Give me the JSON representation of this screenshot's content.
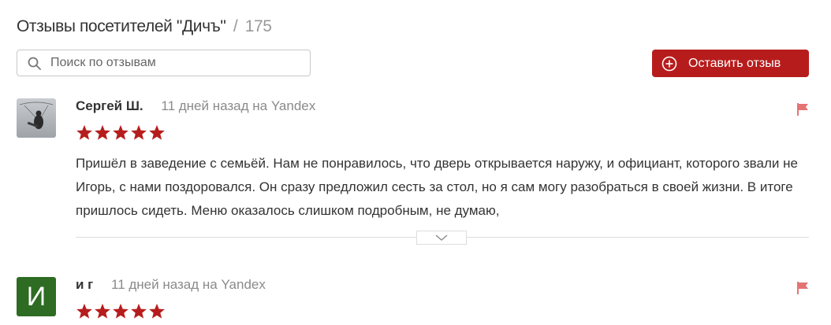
{
  "header": {
    "title": "Отзывы посетителей \"Дичъ\"",
    "separator": "/",
    "count": "175"
  },
  "search": {
    "placeholder": "Поиск по отзывам",
    "icon": "search-icon"
  },
  "add_review": {
    "label": "Оставить отзыв",
    "icon": "plus-circle-icon",
    "color": "#b71c1c"
  },
  "reviews": [
    {
      "author": "Сергей Ш.",
      "date": "11 дней назад на Yandex",
      "rating": 5,
      "avatar": "photo",
      "text": "Пришёл в заведение с семьёй. Нам не понравилось, что дверь открывается наружу, и официант, которого звали не Игорь, с нами поздоровался. Он сразу предложил сесть за стол, но я сам могу разобраться в своей жизни. В итоге пришлось сидеть. Меню оказалось слишком подробным, не думаю,"
    },
    {
      "author": "и г",
      "date": "11 дней назад на Yandex",
      "rating": 5,
      "avatar": "letter",
      "avatar_letter": "И",
      "avatar_color": "#2e6b23"
    }
  ],
  "colors": {
    "star": "#b71c1c",
    "flag": "#e57373"
  }
}
